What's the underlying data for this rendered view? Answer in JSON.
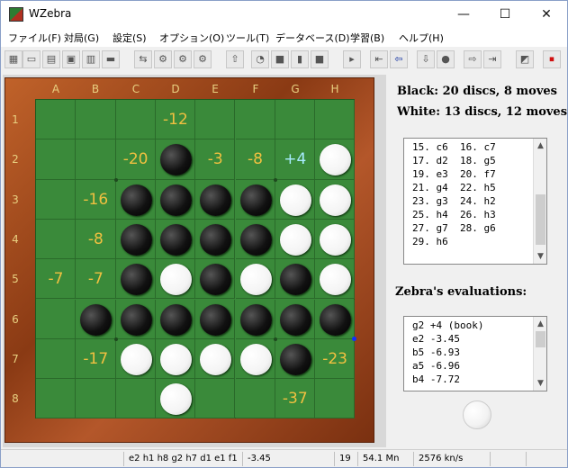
{
  "window": {
    "title": "WZebra",
    "icon": "wzebra-app-icon"
  },
  "title_buttons": {
    "minimize": "—",
    "maximize": "☐",
    "close": "✕"
  },
  "menu": [
    "ファイル(F)",
    "対局(G)",
    "設定(S)",
    "オプション(O)",
    "ツール(T)",
    "データベース(D)",
    "学習(B)",
    "ヘルプ(H)"
  ],
  "toolbar": {
    "icons": [
      "board-setup-icon",
      "new-game-icon",
      "open-icon",
      "save-icon",
      "print-icon",
      "folder-icon",
      "switch-sides-icon",
      "computer-black-icon",
      "computer-white-icon",
      "two-computers-icon",
      "analyze-icon",
      "clock-icon",
      "stop-icon",
      "pause-icon",
      "square-icon",
      "hint-icon",
      "go-first-icon",
      "go-back-icon",
      "go-down-icon",
      "lightbulb-icon",
      "go-forward-icon",
      "go-last-icon",
      "flip-board-icon",
      "stop-red-icon"
    ]
  },
  "board": {
    "columns": [
      "A",
      "B",
      "C",
      "D",
      "E",
      "F",
      "G",
      "H"
    ],
    "rows": [
      "1",
      "2",
      "3",
      "4",
      "5",
      "6",
      "7",
      "8"
    ],
    "cells": [
      [
        "",
        "",
        "",
        "",
        "",
        "",
        "",
        ""
      ],
      [
        "",
        "",
        "",
        "B",
        "",
        "",
        "",
        "W"
      ],
      [
        "",
        "",
        "B",
        "B",
        "B",
        "B",
        "W",
        "W"
      ],
      [
        "",
        "",
        "B",
        "B",
        "B",
        "B",
        "W",
        "W"
      ],
      [
        "",
        "",
        "B",
        "W",
        "B",
        "W",
        "B",
        "W"
      ],
      [
        "",
        "B",
        "B",
        "B",
        "B",
        "B",
        "B",
        "B"
      ],
      [
        "",
        "",
        "W",
        "W",
        "W",
        "W",
        "B",
        ""
      ],
      [
        "",
        "",
        "",
        "W",
        "",
        "",
        "",
        ""
      ]
    ],
    "evals": [
      [
        "",
        "",
        "",
        "-12",
        "",
        "",
        "",
        ""
      ],
      [
        "",
        "",
        "-20",
        "",
        "-3",
        "-8",
        "+4",
        ""
      ],
      [
        "",
        "-16",
        "",
        "",
        "",
        "",
        "",
        ""
      ],
      [
        "",
        "-8",
        "",
        "",
        "",
        "",
        "",
        ""
      ],
      [
        "-7",
        "-7",
        "",
        "",
        "",
        "",
        "",
        ""
      ],
      [
        "",
        "",
        "",
        "",
        "",
        "",
        "",
        ""
      ],
      [
        "",
        "-17",
        "",
        "",
        "",
        "",
        "",
        "-23"
      ],
      [
        "",
        "",
        "",
        "",
        "",
        "",
        "-37",
        ""
      ]
    ],
    "best_move": "g2",
    "last_move": "h6"
  },
  "score": {
    "black": "Black:   20 discs, 8 moves",
    "white": "White:   13 discs, 12 moves"
  },
  "move_list": [
    "15. c6  16. c7",
    "17. d2  18. g5",
    "19. e3  20. f7",
    "21. g4  22. h5",
    "23. g3  24. h2",
    "25. h4  26. h3",
    "27. g7  28. g6",
    "29. h6"
  ],
  "evaluations_title": "Zebra's evaluations:",
  "evaluations": [
    "g2 +4 (book)",
    "e2 -3.45",
    "b5 -6.93",
    "a5 -6.96",
    "b4 -7.72"
  ],
  "side_to_move": "white",
  "status": {
    "pv": "e2 h1 h8 g2 h7 d1 e1 f1",
    "eval": "-3.45",
    "depth": "19",
    "nodes": "54.1 Mn",
    "speed": "2576 kn/s"
  }
}
